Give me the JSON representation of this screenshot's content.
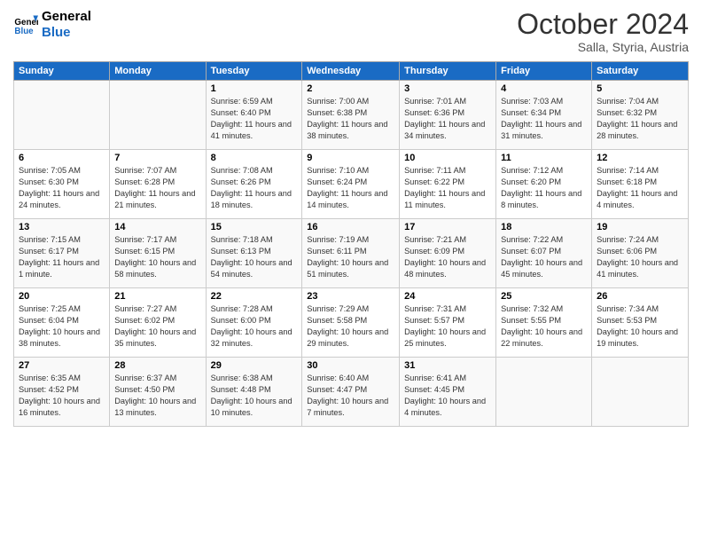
{
  "header": {
    "logo_line1": "General",
    "logo_line2": "Blue",
    "month": "October 2024",
    "location": "Salla, Styria, Austria"
  },
  "days_of_week": [
    "Sunday",
    "Monday",
    "Tuesday",
    "Wednesday",
    "Thursday",
    "Friday",
    "Saturday"
  ],
  "weeks": [
    [
      {
        "day": "",
        "info": ""
      },
      {
        "day": "",
        "info": ""
      },
      {
        "day": "1",
        "info": "Sunrise: 6:59 AM\nSunset: 6:40 PM\nDaylight: 11 hours and 41 minutes."
      },
      {
        "day": "2",
        "info": "Sunrise: 7:00 AM\nSunset: 6:38 PM\nDaylight: 11 hours and 38 minutes."
      },
      {
        "day": "3",
        "info": "Sunrise: 7:01 AM\nSunset: 6:36 PM\nDaylight: 11 hours and 34 minutes."
      },
      {
        "day": "4",
        "info": "Sunrise: 7:03 AM\nSunset: 6:34 PM\nDaylight: 11 hours and 31 minutes."
      },
      {
        "day": "5",
        "info": "Sunrise: 7:04 AM\nSunset: 6:32 PM\nDaylight: 11 hours and 28 minutes."
      }
    ],
    [
      {
        "day": "6",
        "info": "Sunrise: 7:05 AM\nSunset: 6:30 PM\nDaylight: 11 hours and 24 minutes."
      },
      {
        "day": "7",
        "info": "Sunrise: 7:07 AM\nSunset: 6:28 PM\nDaylight: 11 hours and 21 minutes."
      },
      {
        "day": "8",
        "info": "Sunrise: 7:08 AM\nSunset: 6:26 PM\nDaylight: 11 hours and 18 minutes."
      },
      {
        "day": "9",
        "info": "Sunrise: 7:10 AM\nSunset: 6:24 PM\nDaylight: 11 hours and 14 minutes."
      },
      {
        "day": "10",
        "info": "Sunrise: 7:11 AM\nSunset: 6:22 PM\nDaylight: 11 hours and 11 minutes."
      },
      {
        "day": "11",
        "info": "Sunrise: 7:12 AM\nSunset: 6:20 PM\nDaylight: 11 hours and 8 minutes."
      },
      {
        "day": "12",
        "info": "Sunrise: 7:14 AM\nSunset: 6:18 PM\nDaylight: 11 hours and 4 minutes."
      }
    ],
    [
      {
        "day": "13",
        "info": "Sunrise: 7:15 AM\nSunset: 6:17 PM\nDaylight: 11 hours and 1 minute."
      },
      {
        "day": "14",
        "info": "Sunrise: 7:17 AM\nSunset: 6:15 PM\nDaylight: 10 hours and 58 minutes."
      },
      {
        "day": "15",
        "info": "Sunrise: 7:18 AM\nSunset: 6:13 PM\nDaylight: 10 hours and 54 minutes."
      },
      {
        "day": "16",
        "info": "Sunrise: 7:19 AM\nSunset: 6:11 PM\nDaylight: 10 hours and 51 minutes."
      },
      {
        "day": "17",
        "info": "Sunrise: 7:21 AM\nSunset: 6:09 PM\nDaylight: 10 hours and 48 minutes."
      },
      {
        "day": "18",
        "info": "Sunrise: 7:22 AM\nSunset: 6:07 PM\nDaylight: 10 hours and 45 minutes."
      },
      {
        "day": "19",
        "info": "Sunrise: 7:24 AM\nSunset: 6:06 PM\nDaylight: 10 hours and 41 minutes."
      }
    ],
    [
      {
        "day": "20",
        "info": "Sunrise: 7:25 AM\nSunset: 6:04 PM\nDaylight: 10 hours and 38 minutes."
      },
      {
        "day": "21",
        "info": "Sunrise: 7:27 AM\nSunset: 6:02 PM\nDaylight: 10 hours and 35 minutes."
      },
      {
        "day": "22",
        "info": "Sunrise: 7:28 AM\nSunset: 6:00 PM\nDaylight: 10 hours and 32 minutes."
      },
      {
        "day": "23",
        "info": "Sunrise: 7:29 AM\nSunset: 5:58 PM\nDaylight: 10 hours and 29 minutes."
      },
      {
        "day": "24",
        "info": "Sunrise: 7:31 AM\nSunset: 5:57 PM\nDaylight: 10 hours and 25 minutes."
      },
      {
        "day": "25",
        "info": "Sunrise: 7:32 AM\nSunset: 5:55 PM\nDaylight: 10 hours and 22 minutes."
      },
      {
        "day": "26",
        "info": "Sunrise: 7:34 AM\nSunset: 5:53 PM\nDaylight: 10 hours and 19 minutes."
      }
    ],
    [
      {
        "day": "27",
        "info": "Sunrise: 6:35 AM\nSunset: 4:52 PM\nDaylight: 10 hours and 16 minutes."
      },
      {
        "day": "28",
        "info": "Sunrise: 6:37 AM\nSunset: 4:50 PM\nDaylight: 10 hours and 13 minutes."
      },
      {
        "day": "29",
        "info": "Sunrise: 6:38 AM\nSunset: 4:48 PM\nDaylight: 10 hours and 10 minutes."
      },
      {
        "day": "30",
        "info": "Sunrise: 6:40 AM\nSunset: 4:47 PM\nDaylight: 10 hours and 7 minutes."
      },
      {
        "day": "31",
        "info": "Sunrise: 6:41 AM\nSunset: 4:45 PM\nDaylight: 10 hours and 4 minutes."
      },
      {
        "day": "",
        "info": ""
      },
      {
        "day": "",
        "info": ""
      }
    ]
  ]
}
